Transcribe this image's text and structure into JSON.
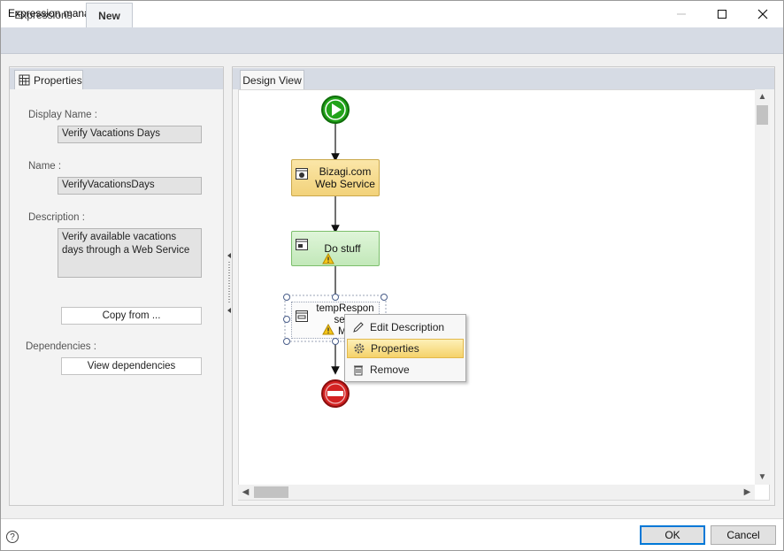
{
  "window": {
    "title": "Expression manager"
  },
  "tabs": [
    {
      "label": "Expressions",
      "active": false
    },
    {
      "label": "New",
      "active": true
    }
  ],
  "properties": {
    "tab_label": "Properties",
    "display_name_label": "Display Name :",
    "display_name_value": "Verify Vacations Days",
    "name_label": "Name :",
    "name_value": "VerifyVacationsDays",
    "description_label": "Description :",
    "description_value": "Verify available vacations days through a Web Service",
    "copy_from_label": "Copy from ...",
    "dependencies_label": "Dependencies :",
    "view_dependencies_label": "View dependencies"
  },
  "design": {
    "tab_label": "Design View",
    "nodes": {
      "web_service": "Bizagi.com Web Service",
      "do_stuff": "Do stuff",
      "selected_line1": "tempRespon",
      "selected_line2": "se to",
      "selected_line3": "Me"
    }
  },
  "context_menu": {
    "items": [
      "Edit Description",
      "Properties",
      "Remove"
    ],
    "highlighted": "Properties"
  },
  "footer": {
    "ok_label": "OK",
    "cancel_label": "Cancel",
    "help_glyph": "?"
  },
  "colors": {
    "accent": "#0078d7",
    "start_event": "#22a31a",
    "end_event": "#d32222",
    "highlight": "#f5d26a"
  }
}
